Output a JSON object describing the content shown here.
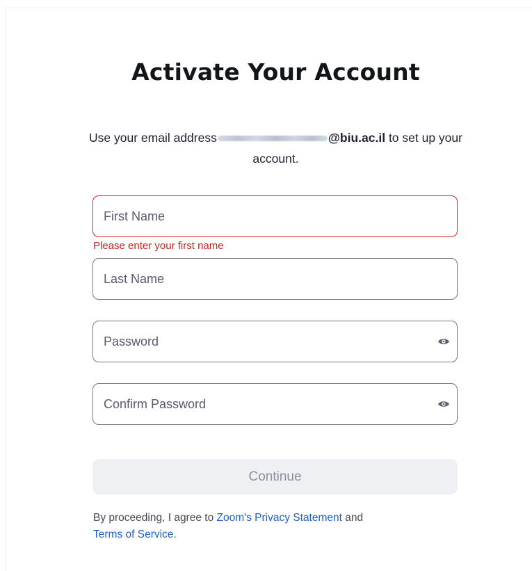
{
  "page": {
    "title": "Activate Your Account",
    "subtitle_prefix": "Use your email address",
    "email_domain": "@biu.ac.il",
    "subtitle_suffix": " to set up your account."
  },
  "form": {
    "first_name": {
      "placeholder": "First Name",
      "value": "",
      "error": "Please enter your first name"
    },
    "last_name": {
      "placeholder": "Last Name",
      "value": ""
    },
    "password": {
      "placeholder": "Password",
      "value": "",
      "icon": "eye-icon"
    },
    "confirm_password": {
      "placeholder": "Confirm Password",
      "value": "",
      "icon": "eye-icon"
    },
    "continue_label": "Continue"
  },
  "legal": {
    "prefix": "By proceeding, I agree to ",
    "privacy_link": "Zoom's Privacy Statement",
    "middle": " and ",
    "terms_link": "Terms of Service",
    "suffix": "."
  },
  "colors": {
    "error": "#e02828",
    "link": "#1e5fd4",
    "button_disabled_bg": "#eef0f3",
    "button_disabled_text": "#8c8e9a"
  }
}
